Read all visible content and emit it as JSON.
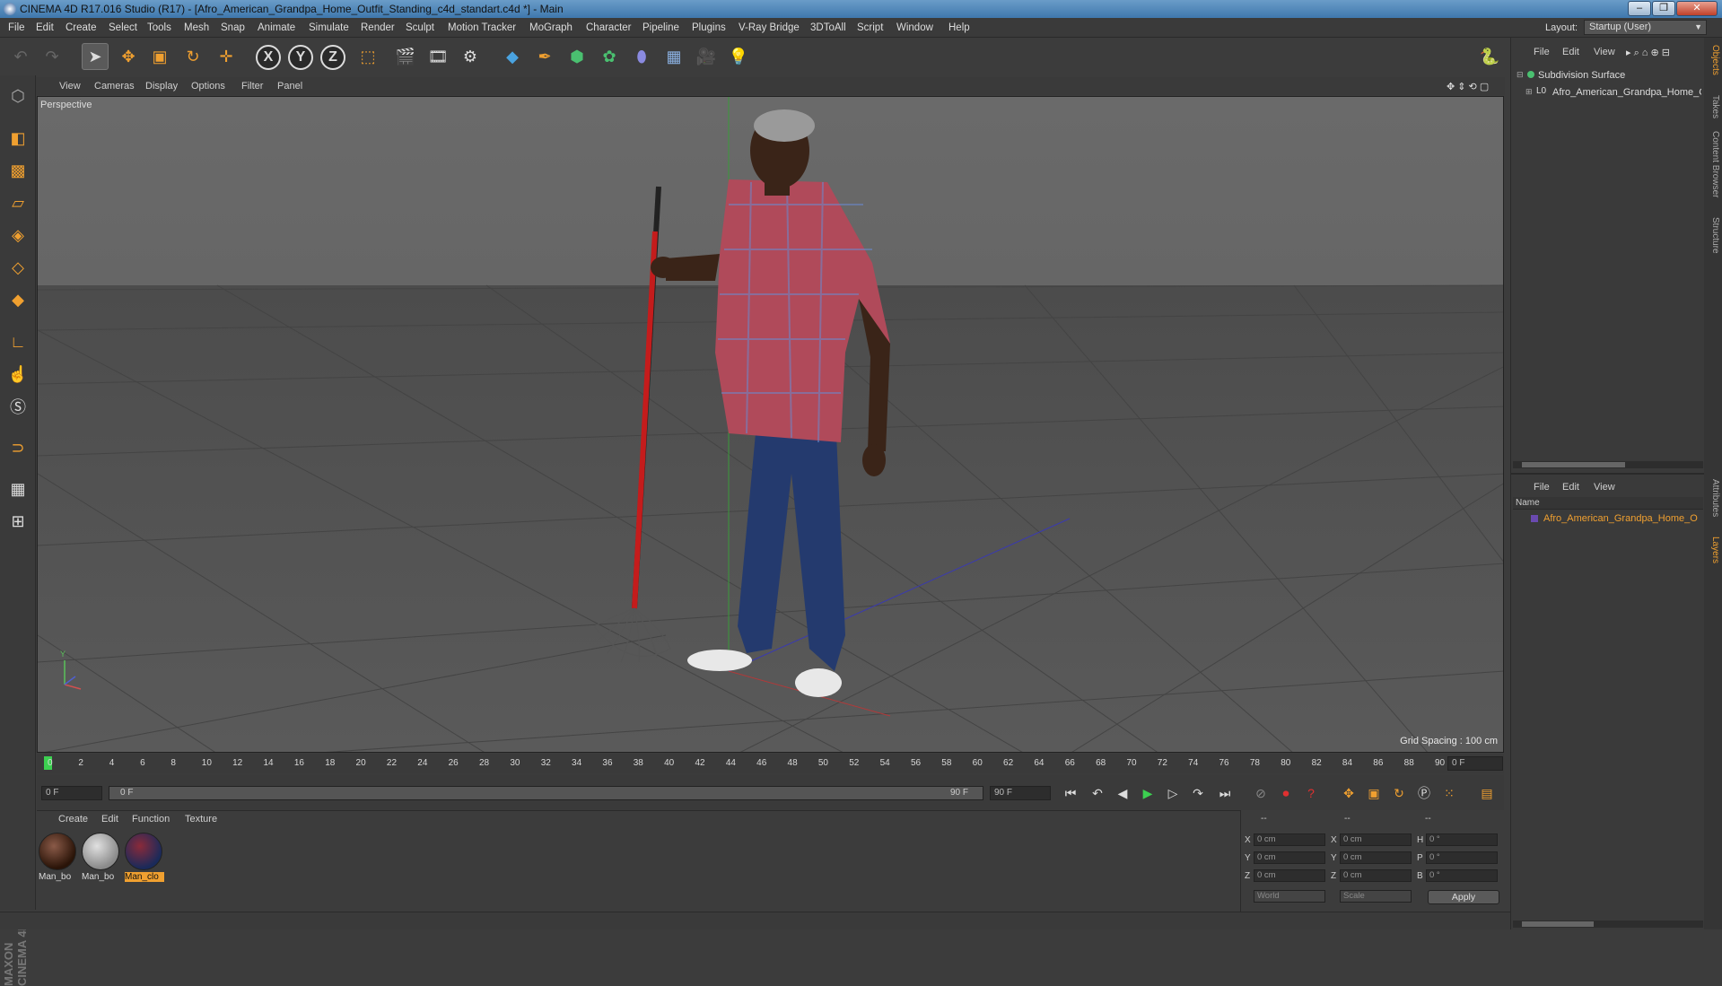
{
  "window": {
    "title": "CINEMA 4D R17.016 Studio (R17) - [Afro_American_Grandpa_Home_Outfit_Standing_c4d_standart.c4d *] - Main",
    "minimize": "–",
    "restore": "❐",
    "close": "✕"
  },
  "menu": [
    "File",
    "Edit",
    "Create",
    "Select",
    "Tools",
    "Mesh",
    "Snap",
    "Animate",
    "Simulate",
    "Render",
    "Sculpt",
    "Motion Tracker",
    "MoGraph",
    "Character",
    "Pipeline",
    "Plugins",
    "V-Ray Bridge",
    "3DToAll",
    "Script",
    "Window",
    "Help"
  ],
  "layout": {
    "label": "Layout:",
    "value": "Startup (User)"
  },
  "viewport": {
    "menu": [
      "View",
      "Cameras",
      "Display",
      "Options",
      "Filter",
      "Panel"
    ],
    "label": "Perspective",
    "grid_spacing": "Grid Spacing : 100 cm"
  },
  "timeline": {
    "ticks": [
      "0",
      "2",
      "4",
      "6",
      "8",
      "10",
      "12",
      "14",
      "16",
      "18",
      "20",
      "22",
      "24",
      "26",
      "28",
      "30",
      "32",
      "34",
      "36",
      "38",
      "40",
      "42",
      "44",
      "46",
      "48",
      "50",
      "52",
      "54",
      "56",
      "58",
      "60",
      "62",
      "64",
      "66",
      "68",
      "70",
      "72",
      "74",
      "76",
      "78",
      "80",
      "82",
      "84",
      "86",
      "88",
      "90"
    ],
    "current_frame": "0 F"
  },
  "transport": {
    "start": "0 F",
    "range_start": "0 F",
    "range_end": "90 F",
    "end": "90 F"
  },
  "materials": {
    "menu": [
      "Create",
      "Edit",
      "Function",
      "Texture"
    ],
    "items": [
      {
        "name": "Man_bo",
        "selected": false
      },
      {
        "name": "Man_bo",
        "selected": false
      },
      {
        "name": "Man_clo",
        "selected": true
      }
    ]
  },
  "coordinates": {
    "header": [
      "--",
      "--",
      "--"
    ],
    "rows": [
      {
        "a": "X",
        "av": "0 cm",
        "b": "X",
        "bv": "0 cm",
        "c": "H",
        "cv": "0 °"
      },
      {
        "a": "Y",
        "av": "0 cm",
        "b": "Y",
        "bv": "0 cm",
        "c": "P",
        "cv": "0 °"
      },
      {
        "a": "Z",
        "av": "0 cm",
        "b": "Z",
        "bv": "0 cm",
        "c": "B",
        "cv": "0 °"
      }
    ],
    "space": "World",
    "mode": "Scale",
    "apply": "Apply"
  },
  "objects": {
    "menu": [
      "File",
      "Edit",
      "View"
    ],
    "tree": [
      "Subdivision Surface",
      "Afro_American_Grandpa_Home_O"
    ]
  },
  "layers": {
    "menu": [
      "File",
      "Edit",
      "View"
    ],
    "column": "Name",
    "item": "Afro_American_Grandpa_Home_O"
  },
  "sidetabs": [
    "Objects",
    "Takes",
    "Content Browser",
    "Structure",
    "Attributes",
    "Layers"
  ],
  "brand": "MAXON CINEMA 4D",
  "colors": {
    "accent": "#f0a030",
    "selection": "#f0a030",
    "viewport_bg": "#5a5a5a"
  }
}
